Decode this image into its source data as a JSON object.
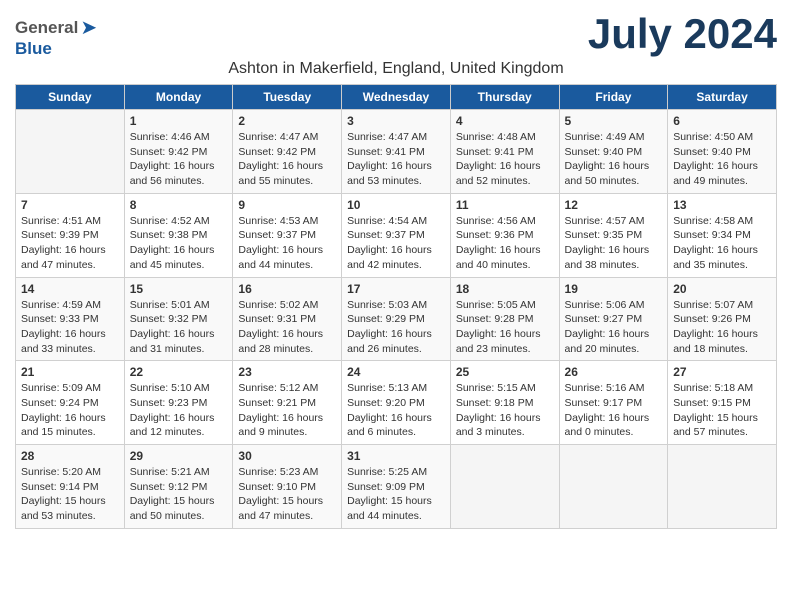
{
  "logo": {
    "general": "General",
    "blue": "Blue"
  },
  "title": "July 2024",
  "subtitle": "Ashton in Makerfield, England, United Kingdom",
  "weekdays": [
    "Sunday",
    "Monday",
    "Tuesday",
    "Wednesday",
    "Thursday",
    "Friday",
    "Saturday"
  ],
  "weeks": [
    [
      {
        "day": "",
        "info": ""
      },
      {
        "day": "1",
        "info": "Sunrise: 4:46 AM\nSunset: 9:42 PM\nDaylight: 16 hours\nand 56 minutes."
      },
      {
        "day": "2",
        "info": "Sunrise: 4:47 AM\nSunset: 9:42 PM\nDaylight: 16 hours\nand 55 minutes."
      },
      {
        "day": "3",
        "info": "Sunrise: 4:47 AM\nSunset: 9:41 PM\nDaylight: 16 hours\nand 53 minutes."
      },
      {
        "day": "4",
        "info": "Sunrise: 4:48 AM\nSunset: 9:41 PM\nDaylight: 16 hours\nand 52 minutes."
      },
      {
        "day": "5",
        "info": "Sunrise: 4:49 AM\nSunset: 9:40 PM\nDaylight: 16 hours\nand 50 minutes."
      },
      {
        "day": "6",
        "info": "Sunrise: 4:50 AM\nSunset: 9:40 PM\nDaylight: 16 hours\nand 49 minutes."
      }
    ],
    [
      {
        "day": "7",
        "info": "Sunrise: 4:51 AM\nSunset: 9:39 PM\nDaylight: 16 hours\nand 47 minutes."
      },
      {
        "day": "8",
        "info": "Sunrise: 4:52 AM\nSunset: 9:38 PM\nDaylight: 16 hours\nand 45 minutes."
      },
      {
        "day": "9",
        "info": "Sunrise: 4:53 AM\nSunset: 9:37 PM\nDaylight: 16 hours\nand 44 minutes."
      },
      {
        "day": "10",
        "info": "Sunrise: 4:54 AM\nSunset: 9:37 PM\nDaylight: 16 hours\nand 42 minutes."
      },
      {
        "day": "11",
        "info": "Sunrise: 4:56 AM\nSunset: 9:36 PM\nDaylight: 16 hours\nand 40 minutes."
      },
      {
        "day": "12",
        "info": "Sunrise: 4:57 AM\nSunset: 9:35 PM\nDaylight: 16 hours\nand 38 minutes."
      },
      {
        "day": "13",
        "info": "Sunrise: 4:58 AM\nSunset: 9:34 PM\nDaylight: 16 hours\nand 35 minutes."
      }
    ],
    [
      {
        "day": "14",
        "info": "Sunrise: 4:59 AM\nSunset: 9:33 PM\nDaylight: 16 hours\nand 33 minutes."
      },
      {
        "day": "15",
        "info": "Sunrise: 5:01 AM\nSunset: 9:32 PM\nDaylight: 16 hours\nand 31 minutes."
      },
      {
        "day": "16",
        "info": "Sunrise: 5:02 AM\nSunset: 9:31 PM\nDaylight: 16 hours\nand 28 minutes."
      },
      {
        "day": "17",
        "info": "Sunrise: 5:03 AM\nSunset: 9:29 PM\nDaylight: 16 hours\nand 26 minutes."
      },
      {
        "day": "18",
        "info": "Sunrise: 5:05 AM\nSunset: 9:28 PM\nDaylight: 16 hours\nand 23 minutes."
      },
      {
        "day": "19",
        "info": "Sunrise: 5:06 AM\nSunset: 9:27 PM\nDaylight: 16 hours\nand 20 minutes."
      },
      {
        "day": "20",
        "info": "Sunrise: 5:07 AM\nSunset: 9:26 PM\nDaylight: 16 hours\nand 18 minutes."
      }
    ],
    [
      {
        "day": "21",
        "info": "Sunrise: 5:09 AM\nSunset: 9:24 PM\nDaylight: 16 hours\nand 15 minutes."
      },
      {
        "day": "22",
        "info": "Sunrise: 5:10 AM\nSunset: 9:23 PM\nDaylight: 16 hours\nand 12 minutes."
      },
      {
        "day": "23",
        "info": "Sunrise: 5:12 AM\nSunset: 9:21 PM\nDaylight: 16 hours\nand 9 minutes."
      },
      {
        "day": "24",
        "info": "Sunrise: 5:13 AM\nSunset: 9:20 PM\nDaylight: 16 hours\nand 6 minutes."
      },
      {
        "day": "25",
        "info": "Sunrise: 5:15 AM\nSunset: 9:18 PM\nDaylight: 16 hours\nand 3 minutes."
      },
      {
        "day": "26",
        "info": "Sunrise: 5:16 AM\nSunset: 9:17 PM\nDaylight: 16 hours\nand 0 minutes."
      },
      {
        "day": "27",
        "info": "Sunrise: 5:18 AM\nSunset: 9:15 PM\nDaylight: 15 hours\nand 57 minutes."
      }
    ],
    [
      {
        "day": "28",
        "info": "Sunrise: 5:20 AM\nSunset: 9:14 PM\nDaylight: 15 hours\nand 53 minutes."
      },
      {
        "day": "29",
        "info": "Sunrise: 5:21 AM\nSunset: 9:12 PM\nDaylight: 15 hours\nand 50 minutes."
      },
      {
        "day": "30",
        "info": "Sunrise: 5:23 AM\nSunset: 9:10 PM\nDaylight: 15 hours\nand 47 minutes."
      },
      {
        "day": "31",
        "info": "Sunrise: 5:25 AM\nSunset: 9:09 PM\nDaylight: 15 hours\nand 44 minutes."
      },
      {
        "day": "",
        "info": ""
      },
      {
        "day": "",
        "info": ""
      },
      {
        "day": "",
        "info": ""
      }
    ]
  ]
}
